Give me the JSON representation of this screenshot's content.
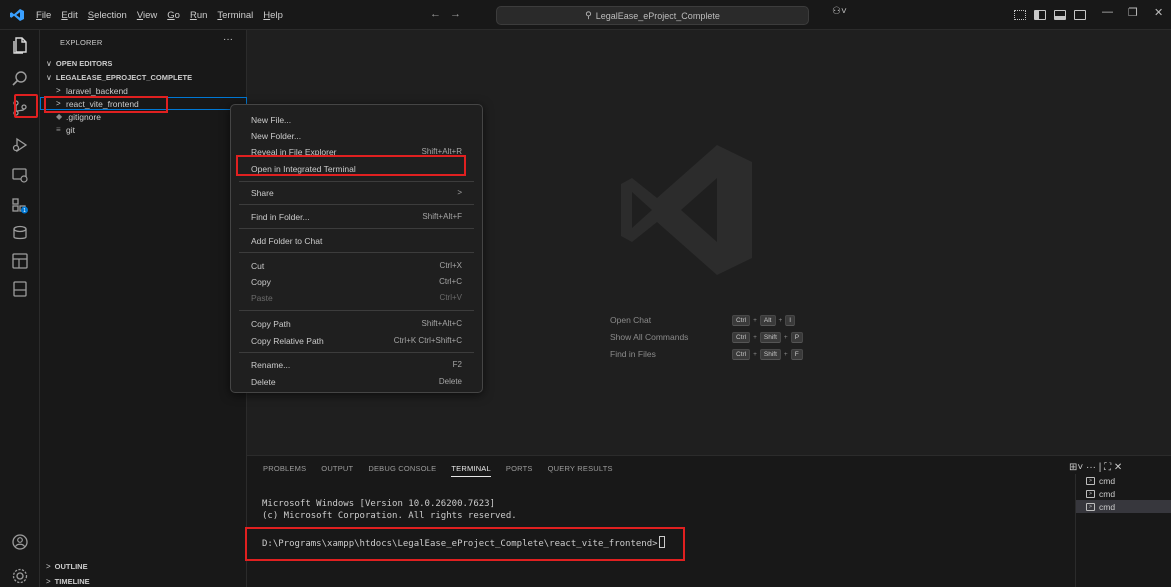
{
  "colors": {
    "accent": "#0078d4",
    "highlight_box": "#e02020",
    "badge": "#0078d4"
  },
  "titlebar": {
    "menus": [
      {
        "label": "File",
        "mnemonic": "F",
        "rest": "ile"
      },
      {
        "label": "Edit",
        "mnemonic": "E",
        "rest": "dit"
      },
      {
        "label": "Selection",
        "mnemonic": "S",
        "rest": "election"
      },
      {
        "label": "View",
        "mnemonic": "V",
        "rest": "iew"
      },
      {
        "label": "Go",
        "mnemonic": "G",
        "rest": "o"
      },
      {
        "label": "Run",
        "mnemonic": "R",
        "rest": "un"
      },
      {
        "label": "Terminal",
        "mnemonic": "T",
        "rest": "erminal"
      },
      {
        "label": "Help",
        "mnemonic": "H",
        "rest": "elp"
      }
    ],
    "back_icon": "arrow-left-icon",
    "forward_icon": "arrow-right-icon",
    "search_text": "LegalEase_eProject_Complete",
    "copilot_icon": "copilot-icon"
  },
  "activitybar": {
    "icons": [
      "files-icon",
      "search-icon",
      "source-control-icon",
      "run-debug-icon",
      "remote-explorer-icon",
      "extensions-icon",
      "database-icon",
      "testing-icon",
      "notebook-icon",
      "account-icon",
      "settings-gear-icon"
    ]
  },
  "sidebar": {
    "title": "EXPLORER",
    "more": "···",
    "open_editors": "OPEN EDITORS",
    "workspace": "LEGALEASE_EPROJECT_COMPLETE",
    "tree": [
      {
        "label": "laravel_backend",
        "chev": ">",
        "icon": ""
      },
      {
        "label": "react_vite_frontend",
        "chev": ">",
        "icon": ""
      },
      {
        "label": ".gitignore",
        "chev": "",
        "icon": "◆"
      },
      {
        "label": "git",
        "chev": "",
        "icon": "≡"
      }
    ],
    "outline": "OUTLINE",
    "timeline": "TIMELINE"
  },
  "context_menu": {
    "items": [
      {
        "label": "New File...",
        "shortcut": ""
      },
      {
        "label": "New Folder...",
        "shortcut": ""
      },
      {
        "label": "Reveal in File Explorer",
        "shortcut": "Shift+Alt+R"
      },
      {
        "label": "Open in Integrated Terminal",
        "shortcut": ""
      },
      {
        "label": "Share",
        "shortcut": ">"
      },
      {
        "label": "Find in Folder...",
        "shortcut": "Shift+Alt+F"
      },
      {
        "label": "Add Folder to Chat",
        "shortcut": ""
      },
      {
        "label": "Cut",
        "shortcut": "Ctrl+X"
      },
      {
        "label": "Copy",
        "shortcut": "Ctrl+C"
      },
      {
        "label": "Paste",
        "shortcut": "Ctrl+V"
      },
      {
        "label": "Copy Path",
        "shortcut": "Shift+Alt+C"
      },
      {
        "label": "Copy Relative Path",
        "shortcut": "Ctrl+K Ctrl+Shift+C"
      },
      {
        "label": "Rename...",
        "shortcut": "F2"
      },
      {
        "label": "Delete",
        "shortcut": "Delete"
      }
    ]
  },
  "editor": {
    "shortcuts": [
      {
        "label": "Open Chat",
        "keys": [
          "Ctrl",
          "Alt",
          "I"
        ]
      },
      {
        "label": "Show All Commands",
        "keys": [
          "Ctrl",
          "Shift",
          "P"
        ]
      },
      {
        "label": "Find in Files",
        "keys": [
          "Ctrl",
          "Shift",
          "F"
        ]
      }
    ]
  },
  "panel": {
    "tabs": [
      "PROBLEMS",
      "OUTPUT",
      "DEBUG CONSOLE",
      "TERMINAL",
      "PORTS",
      "QUERY RESULTS"
    ],
    "active_tab": "TERMINAL",
    "terminal_lines": [
      "Microsoft Windows [Version 10.0.26200.7623]",
      "(c) Microsoft Corporation. All rights reserved."
    ],
    "prompt": "D:\\Programs\\xampp\\htdocs\\LegalEase_eProject_Complete\\react_vite_frontend>",
    "terminals": [
      "cmd",
      "cmd",
      "cmd"
    ],
    "actions": "⊞˅ ··· | ⛶ ✕"
  }
}
